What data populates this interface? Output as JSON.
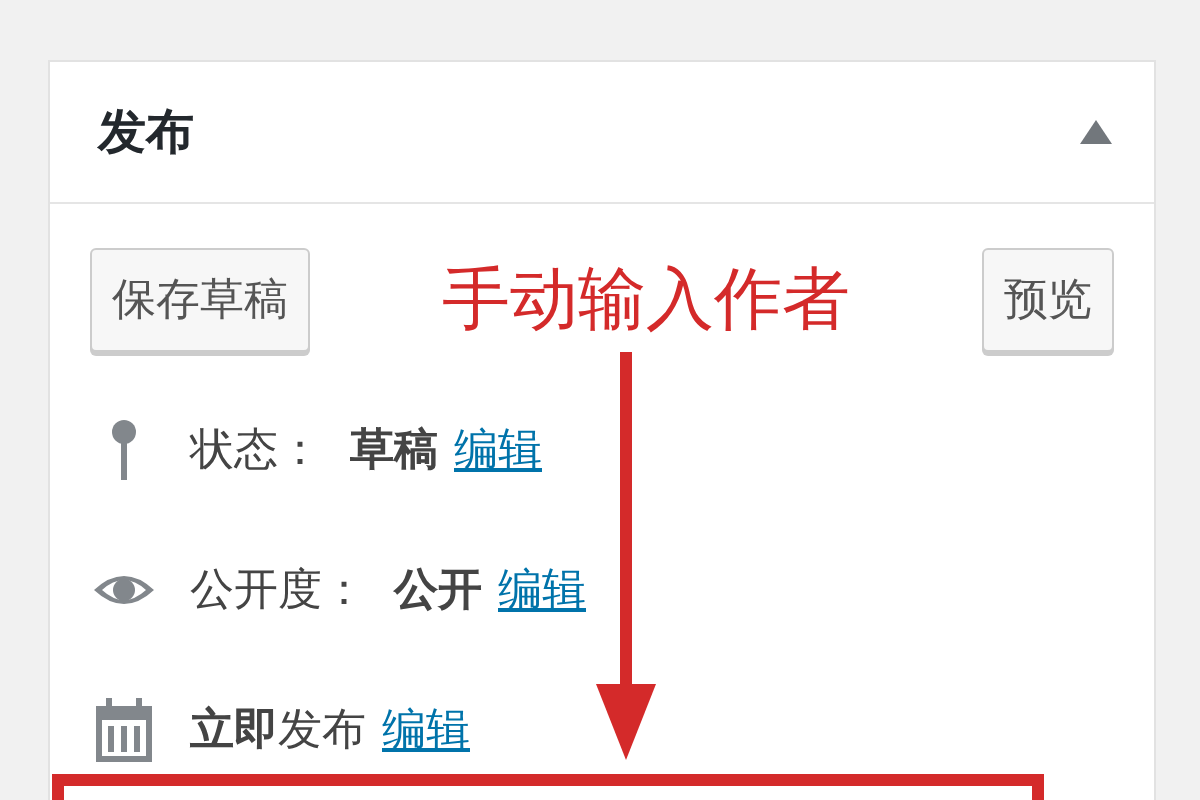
{
  "panel": {
    "title": "发布"
  },
  "buttons": [
    {
      "label": "保存草稿"
    },
    {
      "label": "预览"
    }
  ],
  "annotation": {
    "text": "手动输入作者"
  },
  "rows": [
    {
      "kind": "status",
      "label": "状态：",
      "value": "草稿",
      "link": "编辑"
    },
    {
      "kind": "visibility",
      "label": "公开度：",
      "value": "公开",
      "link": "编辑"
    },
    {
      "kind": "schedule",
      "value": "**立即**发布",
      "link": "编辑"
    }
  ]
}
